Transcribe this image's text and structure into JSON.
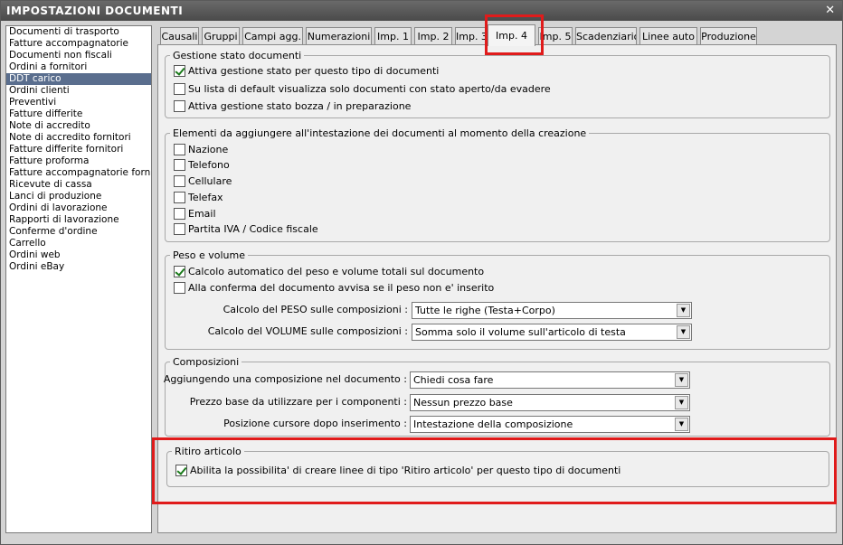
{
  "window": {
    "title": "IMPOSTAZIONI DOCUMENTI",
    "close_symbol": "✕"
  },
  "doc_list": {
    "items": [
      "Documenti di trasporto",
      "Fatture accompagnatorie",
      "Documenti non fiscali",
      "Ordini a fornitori",
      "DDT carico",
      "Ordini clienti",
      "Preventivi",
      "Fatture differite",
      "Note di accredito",
      "Note di accredito fornitori",
      "Fatture differite fornitori",
      "Fatture proforma",
      "Fatture accompagnatorie fornito",
      "Ricevute di cassa",
      "Lanci di produzione",
      "Ordini di lavorazione",
      "Rapporti di lavorazione",
      "Conferme d'ordine",
      "Carrello",
      "Ordini web",
      "Ordini eBay"
    ],
    "selected": "DDT carico"
  },
  "tabs": [
    "Causali",
    "Gruppi",
    "Campi agg.",
    "Numerazioni",
    "Imp. 1",
    "Imp. 2",
    "Imp. 3",
    "Imp. 4",
    "Imp. 5",
    "Scadenziario",
    "Linee auto",
    "Produzione"
  ],
  "active_tab": "Imp. 4",
  "gestione_stato": {
    "title": "Gestione stato documenti",
    "options": [
      {
        "label": "Attiva gestione stato per questo tipo di documenti",
        "checked": true
      },
      {
        "label": "Su lista di default visualizza solo documenti con stato aperto/da evadere",
        "checked": false
      },
      {
        "label": "Attiva gestione stato bozza / in preparazione",
        "checked": false
      }
    ]
  },
  "intestazione": {
    "title": "Elementi da aggiungere all'intestazione dei documenti al momento della creazione",
    "options": [
      {
        "label": "Nazione",
        "checked": false
      },
      {
        "label": "Telefono",
        "checked": false
      },
      {
        "label": "Cellulare",
        "checked": false
      },
      {
        "label": "Telefax",
        "checked": false
      },
      {
        "label": "Email",
        "checked": false
      },
      {
        "label": "Partita IVA / Codice fiscale",
        "checked": false
      }
    ]
  },
  "peso_volume": {
    "title": "Peso e volume",
    "options": [
      {
        "label": "Calcolo automatico del peso e volume totali sul documento",
        "checked": true
      },
      {
        "label": "Alla conferma del documento avvisa se il peso non e' inserito",
        "checked": false
      }
    ],
    "peso_label": "Calcolo del PESO sulle composizioni :",
    "peso_value": "Tutte le righe (Testa+Corpo)",
    "volume_label": "Calcolo del VOLUME sulle composizioni :",
    "volume_value": "Somma solo il volume sull'articolo di testa"
  },
  "composizioni": {
    "title": "Composizioni",
    "aggiungendo_label": "Aggiungendo una composizione nel documento :",
    "aggiungendo_value": "Chiedi cosa fare",
    "prezzo_label": "Prezzo base da utilizzare per i componenti :",
    "prezzo_value": "Nessun prezzo base",
    "posizione_label": "Posizione cursore dopo inserimento :",
    "posizione_value": "Intestazione della composizione"
  },
  "ritiro": {
    "title": "Ritiro articolo",
    "option": {
      "label": "Abilita la possibilita' di creare linee di tipo 'Ritiro articolo' per questo tipo di documenti",
      "checked": true
    }
  },
  "colors": {
    "highlight": "#e01b1b",
    "selection": "#5a6e8e",
    "check": "#1a7a1a"
  },
  "icons": {
    "dropdown": "▼"
  }
}
